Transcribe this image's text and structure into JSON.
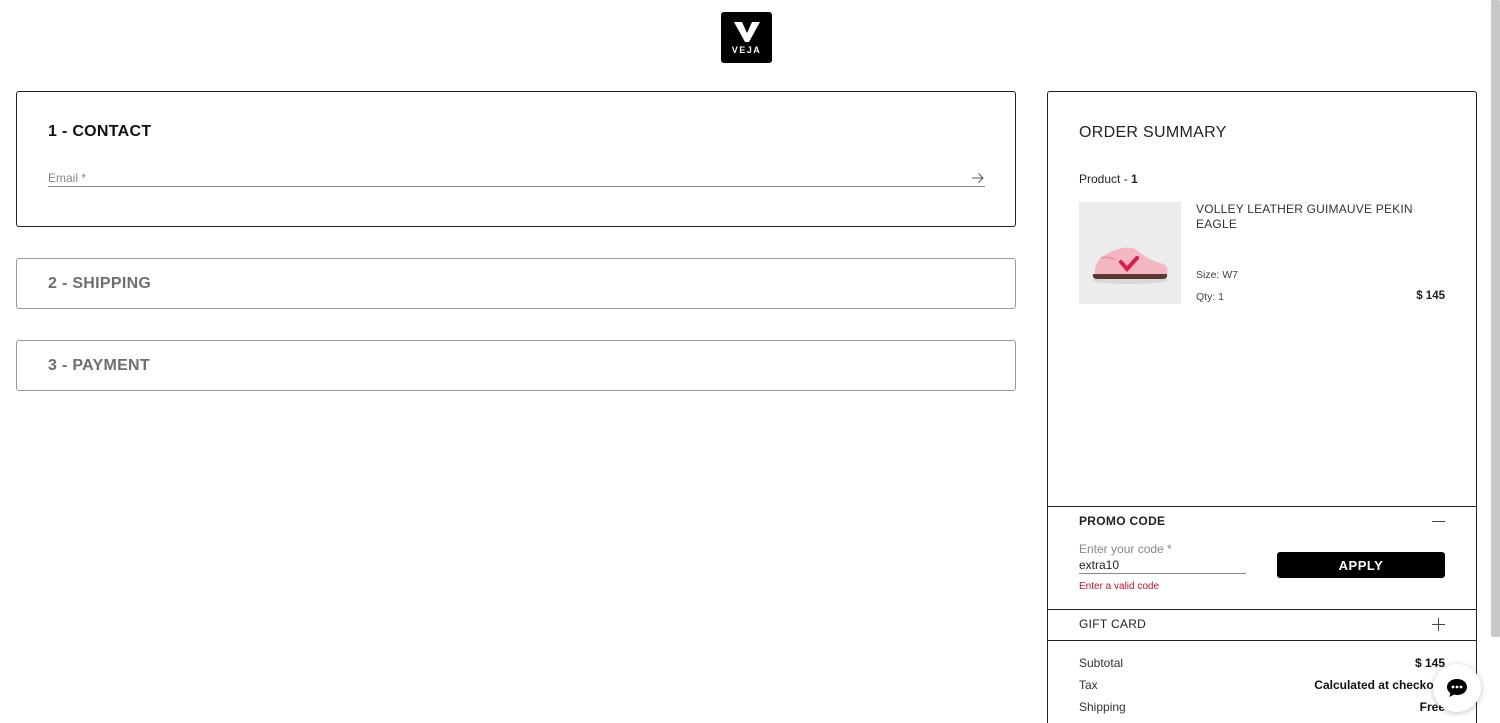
{
  "brand": {
    "logo_text": "VEJA",
    "logo_icon": "veja-v-logo"
  },
  "contact": {
    "title": "1 - CONTACT",
    "email_placeholder": "Email *",
    "submit_icon": "arrow-right-icon"
  },
  "shipping": {
    "title": "2 - SHIPPING"
  },
  "payment": {
    "title": "3 - PAYMENT"
  },
  "summary": {
    "title": "ORDER SUMMARY",
    "product_count_label": "Product - ",
    "product_count": "1",
    "product": {
      "name": "VOLLEY LEATHER GUIMAUVE PEKIN EAGLE",
      "size": "Size: W7",
      "qty": "Qty: 1",
      "price": "$ 145",
      "image_icon": "pink-sneaker-image"
    },
    "promo": {
      "title": "PROMO CODE",
      "placeholder": "Enter your code *",
      "value": "extra10",
      "error": "Enter a valid code",
      "apply_label": "APPLY",
      "toggle_icon": "minus-icon"
    },
    "gift_card": {
      "title": "GIFT CARD",
      "toggle_icon": "plus-icon"
    },
    "totals": [
      {
        "label": "Subtotal",
        "value": "$ 145"
      },
      {
        "label": "Tax",
        "value": "Calculated at checkout"
      },
      {
        "label": "Shipping",
        "value": "Free"
      }
    ]
  },
  "chat": {
    "icon": "chat-bubble-icon"
  },
  "colors": {
    "primary": "#000000",
    "error": "#c0152a",
    "border": "#222222",
    "muted": "#6e6e6e"
  }
}
